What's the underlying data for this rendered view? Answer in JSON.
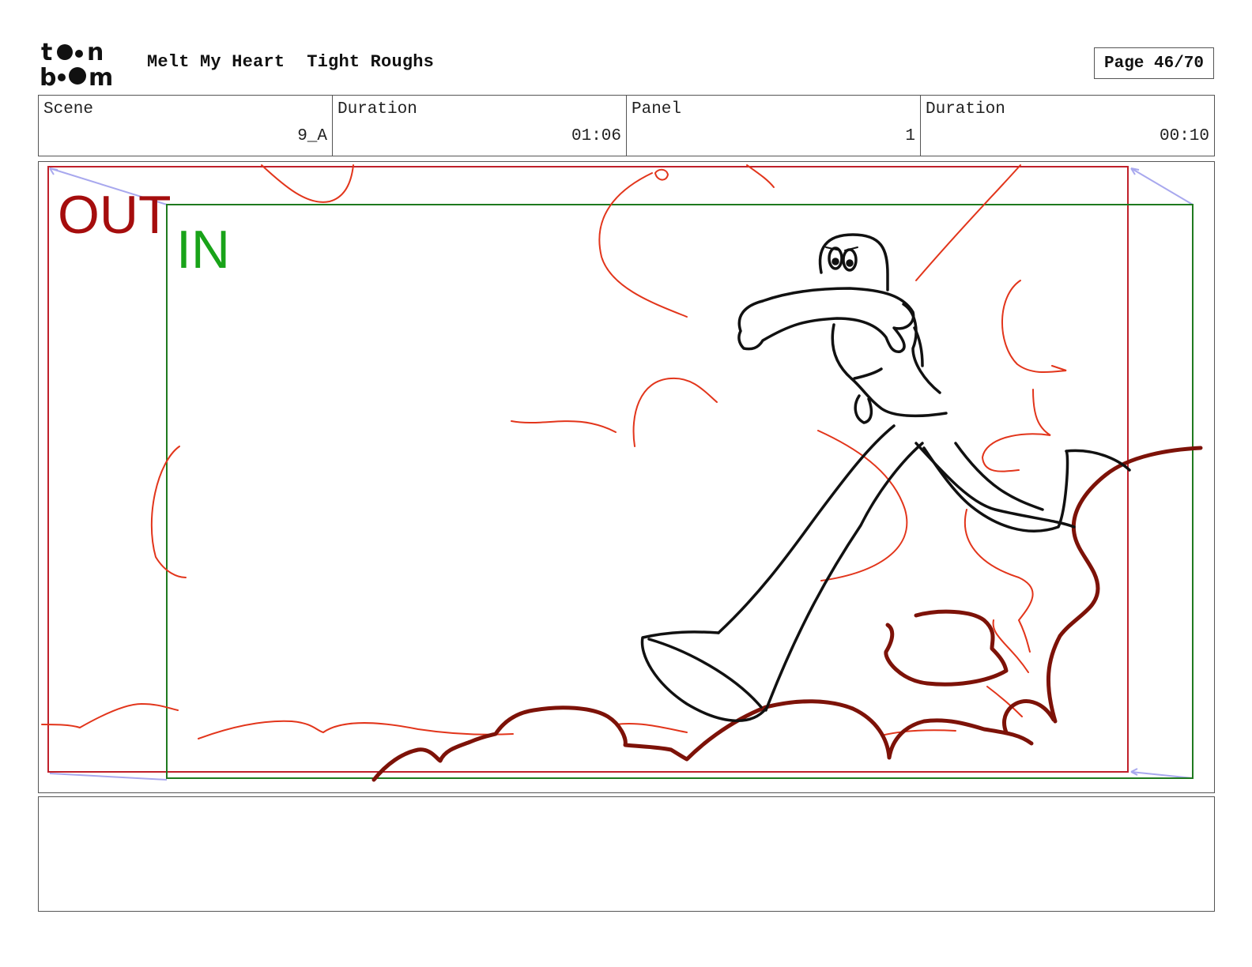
{
  "header": {
    "logo_top": "t••n",
    "logo_bottom": "b••m",
    "project_title": "Melt My Heart",
    "board_name": "Tight Roughs",
    "page_label": "Page 46/70"
  },
  "info": {
    "scene_label": "Scene",
    "scene_value": "9_A",
    "scene_duration_label": "Duration",
    "scene_duration_value": "01:06",
    "panel_label": "Panel",
    "panel_value": "1",
    "panel_duration_label": "Duration",
    "panel_duration_value": "00:10"
  },
  "panel": {
    "out_label": "OUT",
    "in_label": "IN",
    "colors": {
      "out_frame": "#c0202a",
      "out_text": "#a50d0d",
      "in_frame": "#1f7a1f",
      "in_text": "#19a319",
      "character_lines": "#111111",
      "cloud_dark": "#7d1208",
      "cloud_light": "#e2351b",
      "camera_arrows": "#a8a8ee"
    }
  },
  "notes": {
    "text": ""
  }
}
